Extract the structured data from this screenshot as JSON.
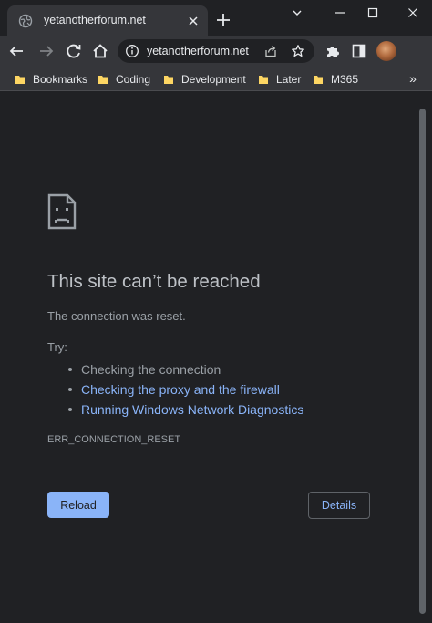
{
  "tab": {
    "title": "yetanotherforum.net",
    "favicon": "globe-icon",
    "close_icon": "close-icon"
  },
  "new_tab_icon": "plus-icon",
  "window_controls": [
    "chevron-down-icon",
    "minimize-icon",
    "maximize-icon",
    "close-icon"
  ],
  "toolbar": {
    "back_icon": "back-arrow-icon",
    "forward_icon": "forward-arrow-icon",
    "reload_icon": "reload-icon",
    "home_icon": "home-icon",
    "url": "yetanotherforum.net",
    "site_info_icon": "info-icon",
    "share_icon": "share-icon",
    "bookmark_icon": "star-icon",
    "extensions_icon": "puzzle-icon",
    "sidepanel_icon": "side-panel-icon",
    "avatar": "profile-avatar"
  },
  "bookmarks": {
    "items": [
      "Bookmarks",
      "Coding",
      "Development",
      "Later",
      "M365"
    ],
    "more_label": "»",
    "folder_color": "#fdd663"
  },
  "error": {
    "icon": "sad-page-icon",
    "title": "This site can’t be reached",
    "subtitle": "The connection was reset.",
    "try_label": "Try:",
    "suggestions": [
      "Checking the connection",
      "Checking the proxy and the firewall",
      "Running Windows Network Diagnostics"
    ],
    "code": "ERR_CONNECTION_RESET",
    "reload_label": "Reload",
    "details_label": "Details"
  },
  "colors": {
    "background": "#202124",
    "toolbar": "#35363a",
    "accent": "#8ab4f8",
    "text_primary": "#bdc1c6",
    "text_secondary": "#9aa0a6"
  }
}
